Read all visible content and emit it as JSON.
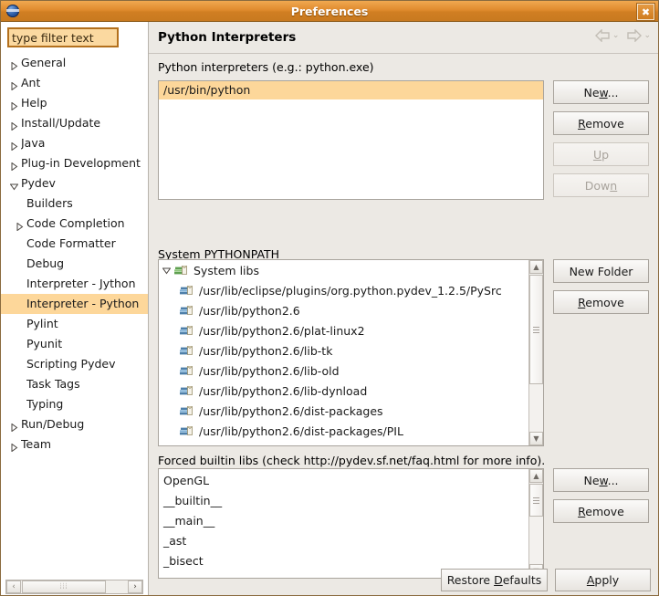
{
  "window": {
    "title": "Preferences",
    "close_label": "✖",
    "app_icon": "eclipse-sphere-icon"
  },
  "sidebar": {
    "filter": {
      "value": "type filter text",
      "placeholder": "type filter text"
    },
    "items": [
      {
        "label": "General",
        "level": 0,
        "expandable": true,
        "expanded": false,
        "selected": false
      },
      {
        "label": "Ant",
        "level": 0,
        "expandable": true,
        "expanded": false,
        "selected": false
      },
      {
        "label": "Help",
        "level": 0,
        "expandable": true,
        "expanded": false,
        "selected": false
      },
      {
        "label": "Install/Update",
        "level": 0,
        "expandable": true,
        "expanded": false,
        "selected": false
      },
      {
        "label": "Java",
        "level": 0,
        "expandable": true,
        "expanded": false,
        "selected": false
      },
      {
        "label": "Plug-in Development",
        "level": 0,
        "expandable": true,
        "expanded": false,
        "selected": false
      },
      {
        "label": "Pydev",
        "level": 0,
        "expandable": true,
        "expanded": true,
        "selected": false
      },
      {
        "label": "Builders",
        "level": 1,
        "expandable": false,
        "expanded": false,
        "selected": false
      },
      {
        "label": "Code Completion",
        "level": 1,
        "expandable": true,
        "expanded": false,
        "selected": false
      },
      {
        "label": "Code Formatter",
        "level": 1,
        "expandable": false,
        "expanded": false,
        "selected": false
      },
      {
        "label": "Debug",
        "level": 1,
        "expandable": false,
        "expanded": false,
        "selected": false
      },
      {
        "label": "Interpreter - Jython",
        "level": 1,
        "expandable": false,
        "expanded": false,
        "selected": false
      },
      {
        "label": "Interpreter - Python",
        "level": 1,
        "expandable": false,
        "expanded": false,
        "selected": true
      },
      {
        "label": "Pylint",
        "level": 1,
        "expandable": false,
        "expanded": false,
        "selected": false
      },
      {
        "label": "Pyunit",
        "level": 1,
        "expandable": false,
        "expanded": false,
        "selected": false
      },
      {
        "label": "Scripting Pydev",
        "level": 1,
        "expandable": false,
        "expanded": false,
        "selected": false
      },
      {
        "label": "Task Tags",
        "level": 1,
        "expandable": false,
        "expanded": false,
        "selected": false
      },
      {
        "label": "Typing",
        "level": 1,
        "expandable": false,
        "expanded": false,
        "selected": false
      },
      {
        "label": "Run/Debug",
        "level": 0,
        "expandable": true,
        "expanded": false,
        "selected": false
      },
      {
        "label": "Team",
        "level": 0,
        "expandable": true,
        "expanded": false,
        "selected": false
      }
    ],
    "hscroll": {
      "left_label": "‹",
      "right_label": "›",
      "thumb_label": "⦙⦙⦙"
    }
  },
  "page": {
    "title": "Python Interpreters",
    "nav": {
      "back": "back-arrow",
      "forward": "forward-arrow",
      "chevron": "⌄"
    }
  },
  "interpreters": {
    "label": "Python interpreters (e.g.: python.exe)",
    "rows": [
      "/usr/bin/python"
    ],
    "selected_index": 0,
    "buttons": [
      {
        "label": "New...",
        "accel": "w",
        "enabled": true
      },
      {
        "label": "Remove",
        "accel": "R",
        "enabled": true
      },
      {
        "label": "Up",
        "accel": "U",
        "enabled": false
      },
      {
        "label": "Down",
        "accel": "n",
        "enabled": false
      }
    ]
  },
  "pythonpath": {
    "label": "System PYTHONPATH",
    "root": {
      "label": "System libs",
      "expanded": true
    },
    "entries": [
      "/usr/lib/eclipse/plugins/org.python.pydev_1.2.5/PySrc",
      "/usr/lib/python2.6",
      "/usr/lib/python2.6/plat-linux2",
      "/usr/lib/python2.6/lib-tk",
      "/usr/lib/python2.6/lib-old",
      "/usr/lib/python2.6/lib-dynload",
      "/usr/lib/python2.6/dist-packages",
      "/usr/lib/python2.6/dist-packages/PIL"
    ],
    "buttons": [
      {
        "label": "New Folder",
        "enabled": true
      },
      {
        "label": "Remove",
        "accel": "R",
        "enabled": true
      }
    ]
  },
  "forced_builtins": {
    "label": "Forced builtin libs (check http://pydev.sf.net/faq.html for more info).",
    "rows": [
      "OpenGL",
      "__builtin__",
      "__main__",
      "_ast",
      "_bisect"
    ],
    "buttons": [
      {
        "label": "New...",
        "accel": "w",
        "enabled": true
      },
      {
        "label": "Remove",
        "accel": "R",
        "enabled": true
      }
    ]
  },
  "footer": {
    "restore_defaults": "Restore Defaults",
    "restore_accel": "D",
    "apply": "Apply",
    "apply_accel": "A"
  },
  "colors": {
    "titlebar": "#e08b2e",
    "selection": "#fdd79a",
    "filter_bg": "#fbd9a0",
    "filter_border": "#b3701d",
    "panel_bg": "#ece9e4"
  }
}
